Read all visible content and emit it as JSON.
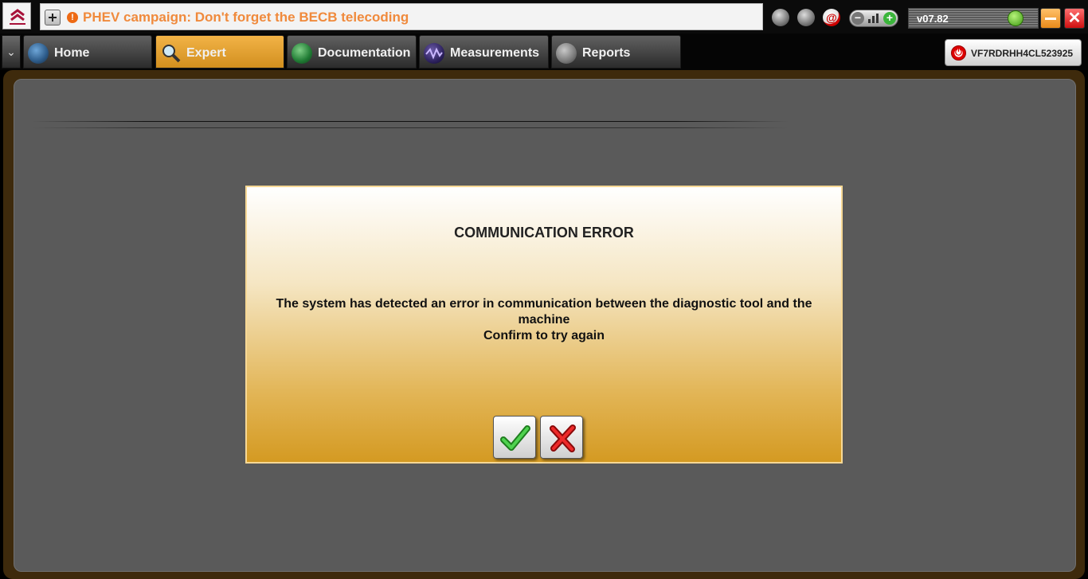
{
  "notification": {
    "text": "PHEV campaign: Don't forget the BECB telecoding",
    "warn_glyph": "!",
    "icons": [
      "add-icon",
      "warning-icon"
    ]
  },
  "toolbar": {
    "mail_glyph": "@",
    "volume": {
      "minus": "−",
      "plus": "+"
    },
    "version": "v07.82",
    "close_glyph": "✕"
  },
  "tabs": [
    {
      "label": "Home",
      "icon": "globe-icon",
      "active": false
    },
    {
      "label": "Expert",
      "icon": "magnifier-icon",
      "active": true
    },
    {
      "label": "Documentation",
      "icon": "book-icon",
      "active": false
    },
    {
      "label": "Measurements",
      "icon": "waveform-icon",
      "active": false
    },
    {
      "label": "Reports",
      "icon": "report-icon",
      "active": false
    }
  ],
  "tab_menu_glyph": "⌄",
  "vehicle": {
    "vin": "VF7RDRHH4CL523925",
    "power_glyph": "⏻"
  },
  "dialog": {
    "title": "COMMUNICATION ERROR",
    "message_line1": "The system has detected an error in communication between the diagnostic tool and the machine",
    "message_line2": "Confirm to try again"
  },
  "colors": {
    "accent_orange": "#d28f1e",
    "notification_text": "#f08a3c",
    "panel_bg": "#5a5a5a",
    "confirm_green": "#2fa82f",
    "cancel_red": "#d81818"
  }
}
